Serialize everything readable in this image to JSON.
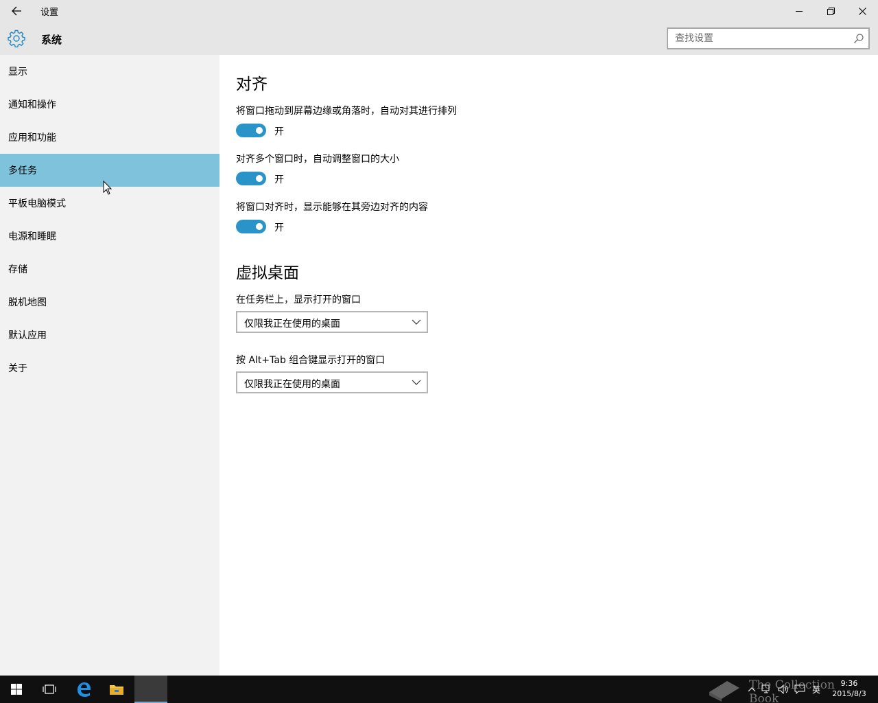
{
  "window": {
    "title": "设置",
    "controls": {
      "minimize": "minimize-icon",
      "maximize": "restore-icon",
      "close": "close-icon"
    }
  },
  "header": {
    "section_title": "系统",
    "search_placeholder": "查找设置"
  },
  "sidebar": {
    "items": [
      {
        "label": "显示"
      },
      {
        "label": "通知和操作"
      },
      {
        "label": "应用和功能"
      },
      {
        "label": "多任务"
      },
      {
        "label": "平板电脑模式"
      },
      {
        "label": "电源和睡眠"
      },
      {
        "label": "存储"
      },
      {
        "label": "脱机地图"
      },
      {
        "label": "默认应用"
      },
      {
        "label": "关于"
      }
    ],
    "selected": "多任务"
  },
  "main": {
    "snap": {
      "heading": "对齐",
      "options": [
        {
          "label": "将窗口拖动到屏幕边缘或角落时，自动对其进行排列",
          "state": "开",
          "on": true
        },
        {
          "label": "对齐多个窗口时，自动调整窗口的大小",
          "state": "开",
          "on": true
        },
        {
          "label": "将窗口对齐时，显示能够在其旁边对齐的内容",
          "state": "开",
          "on": true
        }
      ]
    },
    "virtual_desktops": {
      "heading": "虚拟桌面",
      "settings": [
        {
          "label": "在任务栏上，显示打开的窗口",
          "value": "仅限我正在使用的桌面"
        },
        {
          "label": "按 Alt+Tab 组合键显示打开的窗口",
          "value": "仅限我正在使用的桌面"
        }
      ]
    }
  },
  "taskbar": {
    "clock_time": "9:36",
    "clock_date": "2015/8/3",
    "ime": "英",
    "watermark": "The Collection Book"
  },
  "colors": {
    "accent": "#2a94c8",
    "selected_nav": "#7ec2dc",
    "chrome": "#e6e6e6",
    "sidebar": "#f2f2f2",
    "taskbar": "#101010"
  }
}
